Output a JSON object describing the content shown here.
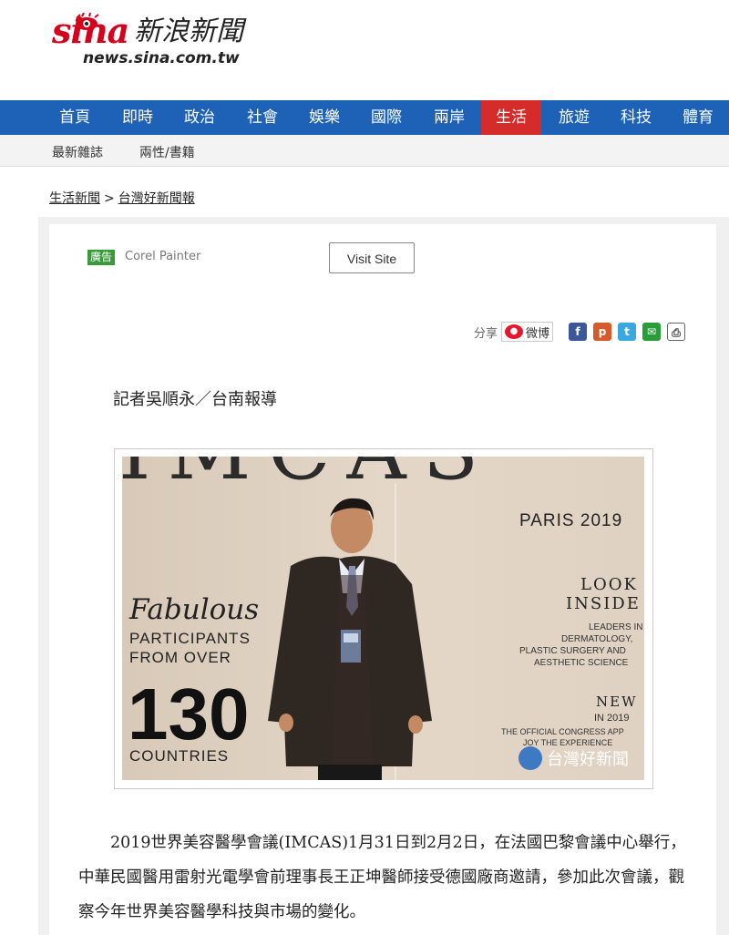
{
  "header": {
    "logo_brand": "sina",
    "logo_cn": "新浪新聞",
    "logo_domain": "news.sina.com.tw"
  },
  "nav": {
    "items": [
      "首頁",
      "即時",
      "政治",
      "社會",
      "娛樂",
      "國際",
      "兩岸",
      "生活",
      "旅遊",
      "科技",
      "體育"
    ],
    "active": "生活"
  },
  "subnav": {
    "items": [
      "最新雜誌",
      "兩性/書籍"
    ]
  },
  "breadcrumb": {
    "items": [
      "生活新聞",
      "台灣好新聞報"
    ],
    "separator": ">"
  },
  "ad": {
    "badge": "廣告",
    "advertiser": "Corel Painter",
    "button": "Visit Site"
  },
  "share": {
    "label": "分享",
    "weibo": "微博",
    "icons": [
      "facebook-icon",
      "plurk-icon",
      "twitter-icon",
      "line-icon",
      "print-icon"
    ],
    "colors": [
      "#3b5998",
      "#d65a2b",
      "#3aa7e0",
      "#2a9d3a",
      "#666666"
    ]
  },
  "byline": "記者吳順永／台南報導",
  "photo": {
    "top_text": "IMCAS",
    "event": "PARIS 2019",
    "look": "LOOK",
    "inside": "INSIDE",
    "leaders": [
      "LEADERS IN",
      "DERMATOLOGY,",
      "PLASTIC SURGERY AND",
      "AESTHETIC SCIENCE"
    ],
    "fabulous": "Fabulous",
    "participants": [
      "PARTICIPANTS",
      "FROM OVER"
    ],
    "number": "130",
    "countries": "COUNTRIES",
    "new": "NEW",
    "in_year": "IN 2019",
    "app": [
      "THE OFFICIAL CONGRESS APP",
      "JOY THE EXPERIENCE"
    ],
    "watermark": "台灣好新聞"
  },
  "article": {
    "paragraph": "2019世界美容醫學會議(IMCAS)1月31日到2月2日，在法國巴黎會議中心舉行，中華民國醫用雷射光電學會前理事長王正坤醫師接受德國廠商邀請，參加此次會議，觀察今年世界美容醫學科技與市場的變化。"
  }
}
